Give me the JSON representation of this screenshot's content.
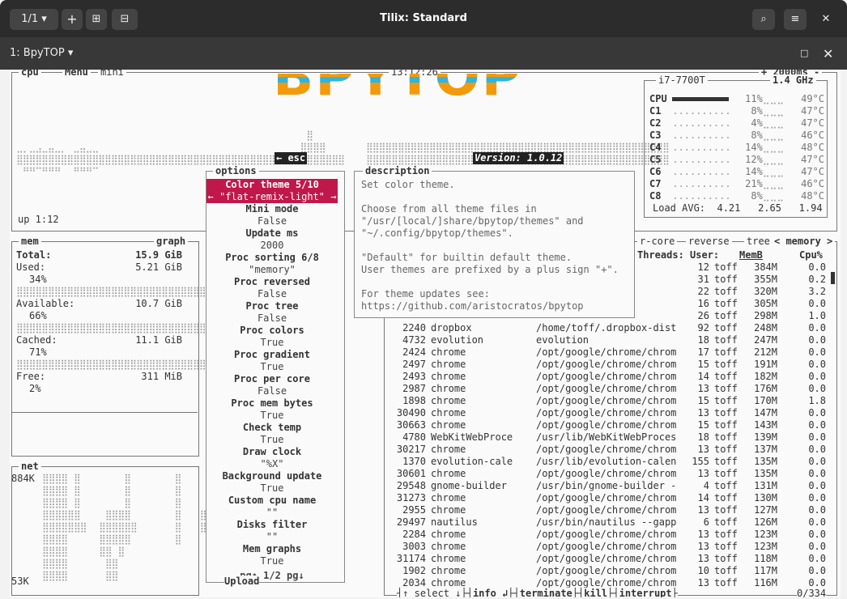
{
  "window": {
    "title": "Tilix: Standard",
    "session_label": "1/1",
    "tab_label": "1: BpyTOP"
  },
  "app": {
    "logo": "BPYTOP",
    "esc_label": "← esc",
    "version": "Version: 1.0.12",
    "clock": "13:12:26",
    "update_ms": "+ 2000ms -",
    "uptime": "up 1:12"
  },
  "cpu_box": {
    "tabs": [
      "cpu",
      "Menu",
      "mini"
    ],
    "model": "i7-7700T",
    "freq": "1.4 GHz",
    "cores": [
      {
        "name": "CPU",
        "pct": "11%",
        "temp": "49°C"
      },
      {
        "name": "C1",
        "pct": "8%",
        "temp": "47°C"
      },
      {
        "name": "C2",
        "pct": "4%",
        "temp": "47°C"
      },
      {
        "name": "C3",
        "pct": "8%",
        "temp": "46°C"
      },
      {
        "name": "C4",
        "pct": "14%",
        "temp": "48°C"
      },
      {
        "name": "C5",
        "pct": "12%",
        "temp": "47°C"
      },
      {
        "name": "C6",
        "pct": "14%",
        "temp": "47°C"
      },
      {
        "name": "C7",
        "pct": "21%",
        "temp": "46°C"
      },
      {
        "name": "C8",
        "pct": "8%",
        "temp": "48°C"
      }
    ],
    "load_label": "Load AVG:",
    "load": [
      "4.21",
      "2.65",
      "1.94"
    ]
  },
  "mem_box": {
    "title": "mem",
    "graph_label": "graph",
    "total_label": "Total:",
    "total": "15.9 GiB",
    "used_label": "Used:",
    "used": "5.21 GiB",
    "used_pct": "34%",
    "avail_label": "Available:",
    "avail": "10.7 GiB",
    "avail_pct": "66%",
    "cached_label": "Cached:",
    "cached": "11.1 GiB",
    "cached_pct": "71%",
    "free_label": "Free:",
    "free": "311 MiB",
    "free_pct": "2%"
  },
  "net_box": {
    "title": "net",
    "top": "884K",
    "bottom": "53K"
  },
  "options": {
    "title": "options",
    "selected_name": "Color theme 5/10",
    "selected_value": "← \"flat-remix-light\" →",
    "items": [
      {
        "name": "Mini mode",
        "value": "False"
      },
      {
        "name": "Update ms",
        "value": "2000"
      },
      {
        "name": "Proc sorting 6/8",
        "value": "\"memory\""
      },
      {
        "name": "Proc reversed",
        "value": "False"
      },
      {
        "name": "Proc tree",
        "value": "False"
      },
      {
        "name": "Proc colors",
        "value": "True"
      },
      {
        "name": "Proc gradient",
        "value": "True"
      },
      {
        "name": "Proc per core",
        "value": "False"
      },
      {
        "name": "Proc mem bytes",
        "value": "True"
      },
      {
        "name": "Check temp",
        "value": "True"
      },
      {
        "name": "Draw clock",
        "value": "\"%X\""
      },
      {
        "name": "Background update",
        "value": "True"
      },
      {
        "name": "Custom cpu name",
        "value": "\"\""
      },
      {
        "name": "Disks filter",
        "value": "\"\""
      },
      {
        "name": "Mem graphs",
        "value": "True"
      }
    ],
    "page": "pg↑ 1/2 pg↓",
    "upload": "Upload"
  },
  "description": {
    "title": "description",
    "lines": [
      "Set color theme.",
      "",
      "Choose from all theme files in",
      "\"/usr/[local/]share/bpytop/themes\" and",
      "\"~/.config/bpytop/themes\".",
      "",
      "\"Default\" for builtin default theme.",
      "User themes are prefixed by a plus sign \"+\".",
      "",
      "For theme updates see:",
      "https://github.com/aristocratos/bpytop"
    ]
  },
  "proc_box": {
    "header_tabs": [
      "r-core",
      "reverse",
      "tree",
      "< memory >"
    ],
    "columns": [
      "Threads:",
      "User:",
      "MemB",
      "Cpu%"
    ],
    "rows": [
      {
        "pid": "",
        "prog": "",
        "cmd": "re",
        "thr": "12",
        "user": "toff",
        "mem": "384M",
        "cpu": "0.0"
      },
      {
        "pid": "",
        "prog": "",
        "cmd": "rom",
        "thr": "31",
        "user": "toff",
        "mem": "355M",
        "cpu": "0.2"
      },
      {
        "pid": "",
        "prog": "",
        "cmd": "rom",
        "thr": "22",
        "user": "toff",
        "mem": "320M",
        "cpu": "3.2"
      },
      {
        "pid": "",
        "prog": "",
        "cmd": "rom",
        "thr": "16",
        "user": "toff",
        "mem": "305M",
        "cpu": "0.0"
      },
      {
        "pid": "",
        "prog": "",
        "cmd": "",
        "thr": "26",
        "user": "toff",
        "mem": "298M",
        "cpu": "1.0"
      },
      {
        "pid": "2240",
        "prog": "dropbox",
        "cmd": "/home/toff/.dropbox-dist",
        "thr": "92",
        "user": "toff",
        "mem": "248M",
        "cpu": "0.0"
      },
      {
        "pid": "4732",
        "prog": "evolution",
        "cmd": "evolution",
        "thr": "18",
        "user": "toff",
        "mem": "247M",
        "cpu": "0.0"
      },
      {
        "pid": "2424",
        "prog": "chrome",
        "cmd": "/opt/google/chrome/chrom",
        "thr": "17",
        "user": "toff",
        "mem": "212M",
        "cpu": "0.0"
      },
      {
        "pid": "2497",
        "prog": "chrome",
        "cmd": "/opt/google/chrome/chrom",
        "thr": "15",
        "user": "toff",
        "mem": "191M",
        "cpu": "0.0"
      },
      {
        "pid": "2493",
        "prog": "chrome",
        "cmd": "/opt/google/chrome/chrom",
        "thr": "14",
        "user": "toff",
        "mem": "182M",
        "cpu": "0.0"
      },
      {
        "pid": "2987",
        "prog": "chrome",
        "cmd": "/opt/google/chrome/chrom",
        "thr": "13",
        "user": "toff",
        "mem": "176M",
        "cpu": "0.0"
      },
      {
        "pid": "1898",
        "prog": "chrome",
        "cmd": "/opt/google/chrome/chrom",
        "thr": "15",
        "user": "toff",
        "mem": "170M",
        "cpu": "1.8"
      },
      {
        "pid": "30490",
        "prog": "chrome",
        "cmd": "/opt/google/chrome/chrom",
        "thr": "13",
        "user": "toff",
        "mem": "147M",
        "cpu": "0.0"
      },
      {
        "pid": "30663",
        "prog": "chrome",
        "cmd": "/opt/google/chrome/chrom",
        "thr": "15",
        "user": "toff",
        "mem": "143M",
        "cpu": "0.0"
      },
      {
        "pid": "4780",
        "prog": "WebKitWebProce",
        "cmd": "/usr/lib/WebKitWebProces",
        "thr": "18",
        "user": "toff",
        "mem": "139M",
        "cpu": "0.0"
      },
      {
        "pid": "30217",
        "prog": "chrome",
        "cmd": "/opt/google/chrome/chrom",
        "thr": "13",
        "user": "toff",
        "mem": "137M",
        "cpu": "0.0"
      },
      {
        "pid": "1370",
        "prog": "evolution-cale",
        "cmd": "/usr/lib/evolution-calen",
        "thr": "155",
        "user": "toff",
        "mem": "135M",
        "cpu": "0.0"
      },
      {
        "pid": "30601",
        "prog": "chrome",
        "cmd": "/opt/google/chrome/chrom",
        "thr": "13",
        "user": "toff",
        "mem": "135M",
        "cpu": "0.0"
      },
      {
        "pid": "29548",
        "prog": "gnome-builder",
        "cmd": "/usr/bin/gnome-builder -",
        "thr": "4",
        "user": "toff",
        "mem": "131M",
        "cpu": "0.0"
      },
      {
        "pid": "31273",
        "prog": "chrome",
        "cmd": "/opt/google/chrome/chrom",
        "thr": "14",
        "user": "toff",
        "mem": "130M",
        "cpu": "0.0"
      },
      {
        "pid": "2955",
        "prog": "chrome",
        "cmd": "/opt/google/chrome/chrom",
        "thr": "13",
        "user": "toff",
        "mem": "127M",
        "cpu": "0.0"
      },
      {
        "pid": "29497",
        "prog": "nautilus",
        "cmd": "/usr/bin/nautilus --gapp",
        "thr": "6",
        "user": "toff",
        "mem": "126M",
        "cpu": "0.0"
      },
      {
        "pid": "2284",
        "prog": "chrome",
        "cmd": "/opt/google/chrome/chrom",
        "thr": "13",
        "user": "toff",
        "mem": "123M",
        "cpu": "0.0"
      },
      {
        "pid": "3003",
        "prog": "chrome",
        "cmd": "/opt/google/chrome/chrom",
        "thr": "13",
        "user": "toff",
        "mem": "123M",
        "cpu": "0.0"
      },
      {
        "pid": "31174",
        "prog": "chrome",
        "cmd": "/opt/google/chrome/chrom",
        "thr": "13",
        "user": "toff",
        "mem": "118M",
        "cpu": "0.0"
      },
      {
        "pid": "1902",
        "prog": "chrome",
        "cmd": "/opt/google/chrome/chrom",
        "thr": "10",
        "user": "toff",
        "mem": "117M",
        "cpu": "0.0"
      },
      {
        "pid": "2034",
        "prog": "chrome",
        "cmd": "/opt/google/chrome/chrom",
        "thr": "13",
        "user": "toff",
        "mem": "116M",
        "cpu": "0.0"
      }
    ],
    "footer": [
      "↑ select ↓",
      "info ↲",
      "terminate",
      "kill",
      "interrupt"
    ],
    "count": "0/334"
  },
  "colors": {
    "selected_bg": "#c0184a",
    "logo_orange": "#f29a0b",
    "logo_blue": "#29b6e5",
    "titlebar": "#2c2c2c"
  }
}
